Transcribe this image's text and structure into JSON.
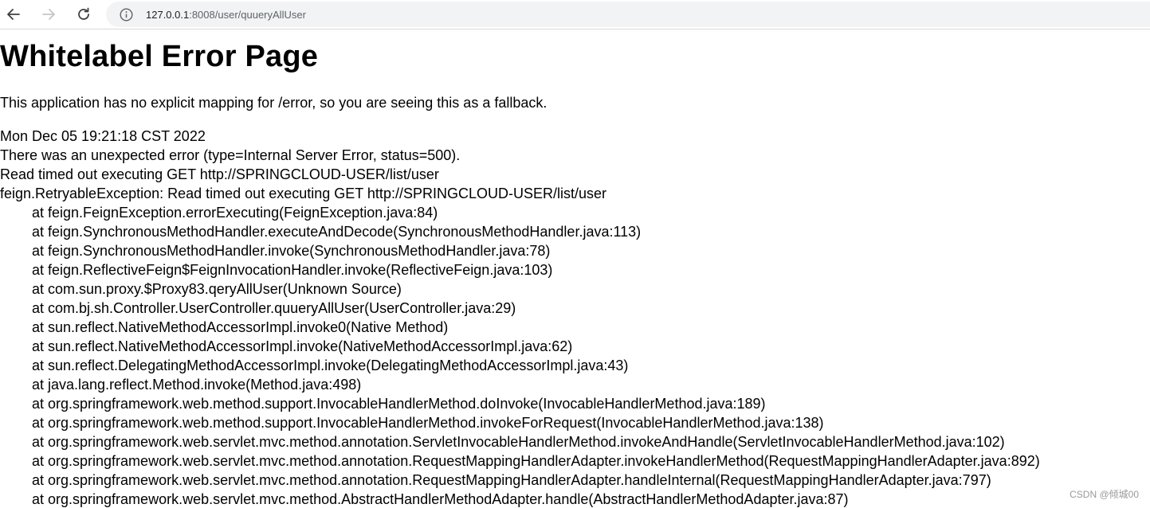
{
  "browser": {
    "url_host": "127.0.0.1",
    "url_rest": ":8008/user/quueryAllUser",
    "icons": {
      "back": "back-arrow-icon",
      "forward": "forward-arrow-icon",
      "reload": "reload-icon",
      "site_info": "info-icon"
    }
  },
  "page": {
    "title": "Whitelabel Error Page",
    "explanation": "This application has no explicit mapping for /error, so you are seeing this as a fallback.",
    "timestamp": "Mon Dec 05 19:21:18 CST 2022",
    "error_summary": "There was an unexpected error (type=Internal Server Error, status=500).",
    "message": "Read timed out executing GET http://SPRINGCLOUD-USER/list/user",
    "exception": "feign.RetryableException: Read timed out executing GET http://SPRINGCLOUD-USER/list/user",
    "stack_trace": [
      "at feign.FeignException.errorExecuting(FeignException.java:84)",
      "at feign.SynchronousMethodHandler.executeAndDecode(SynchronousMethodHandler.java:113)",
      "at feign.SynchronousMethodHandler.invoke(SynchronousMethodHandler.java:78)",
      "at feign.ReflectiveFeign$FeignInvocationHandler.invoke(ReflectiveFeign.java:103)",
      "at com.sun.proxy.$Proxy83.qeryAllUser(Unknown Source)",
      "at com.bj.sh.Controller.UserController.quueryAllUser(UserController.java:29)",
      "at sun.reflect.NativeMethodAccessorImpl.invoke0(Native Method)",
      "at sun.reflect.NativeMethodAccessorImpl.invoke(NativeMethodAccessorImpl.java:62)",
      "at sun.reflect.DelegatingMethodAccessorImpl.invoke(DelegatingMethodAccessorImpl.java:43)",
      "at java.lang.reflect.Method.invoke(Method.java:498)",
      "at org.springframework.web.method.support.InvocableHandlerMethod.doInvoke(InvocableHandlerMethod.java:189)",
      "at org.springframework.web.method.support.InvocableHandlerMethod.invokeForRequest(InvocableHandlerMethod.java:138)",
      "at org.springframework.web.servlet.mvc.method.annotation.ServletInvocableHandlerMethod.invokeAndHandle(ServletInvocableHandlerMethod.java:102)",
      "at org.springframework.web.servlet.mvc.method.annotation.RequestMappingHandlerAdapter.invokeHandlerMethod(RequestMappingHandlerAdapter.java:892)",
      "at org.springframework.web.servlet.mvc.method.annotation.RequestMappingHandlerAdapter.handleInternal(RequestMappingHandlerAdapter.java:797)",
      "at org.springframework.web.servlet.mvc.method.AbstractHandlerMethodAdapter.handle(AbstractHandlerMethodAdapter.java:87)"
    ]
  },
  "watermark": "CSDN @倾城00"
}
